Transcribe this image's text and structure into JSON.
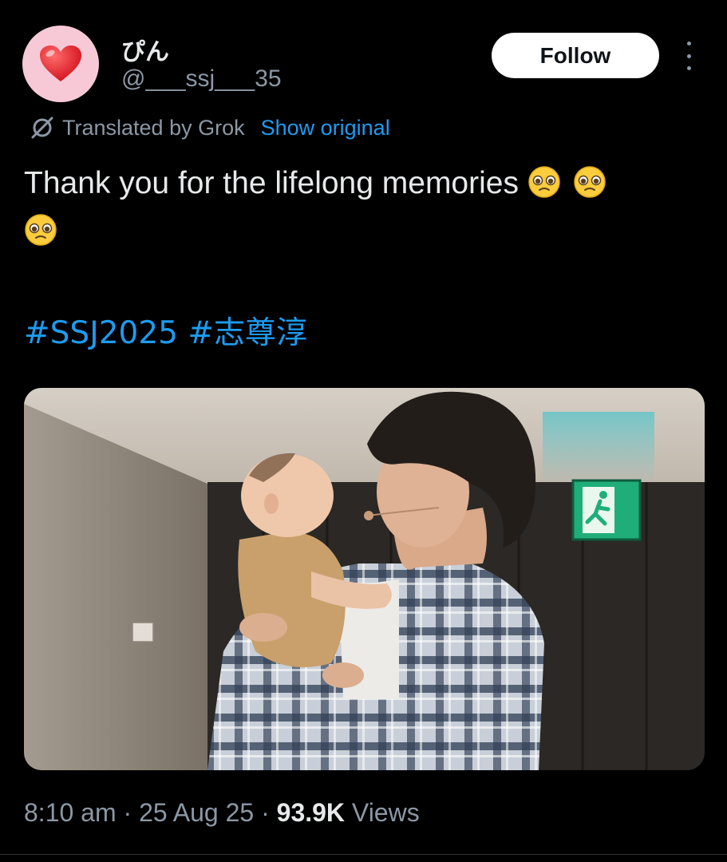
{
  "author": {
    "display_name": "ぴん",
    "handle": "@___ssj___35",
    "avatar_icon": "red-heart-icon"
  },
  "actions": {
    "follow_label": "Follow",
    "more_icon": "more-options-icon"
  },
  "translation": {
    "translated_by": "Translated by Grok",
    "show_original": "Show original"
  },
  "tweet": {
    "text": "Thank you for the lifelong memories",
    "emoji": [
      "pleading-face-emoji",
      "pleading-face-emoji",
      "pleading-face-emoji"
    ],
    "hashtags": [
      "#SSJ2025",
      "#志尊淳"
    ]
  },
  "media": {
    "type": "photo",
    "description_icon": "photo-man-holding-baby"
  },
  "meta": {
    "time": "8:10 am",
    "separator": "·",
    "date": "25 Aug 25",
    "views_count": "93.9K",
    "views_label": "Views"
  },
  "colors": {
    "background": "#000000",
    "text": "#e7e9ea",
    "secondary": "#8b98a5",
    "link": "#1d9bf0"
  }
}
